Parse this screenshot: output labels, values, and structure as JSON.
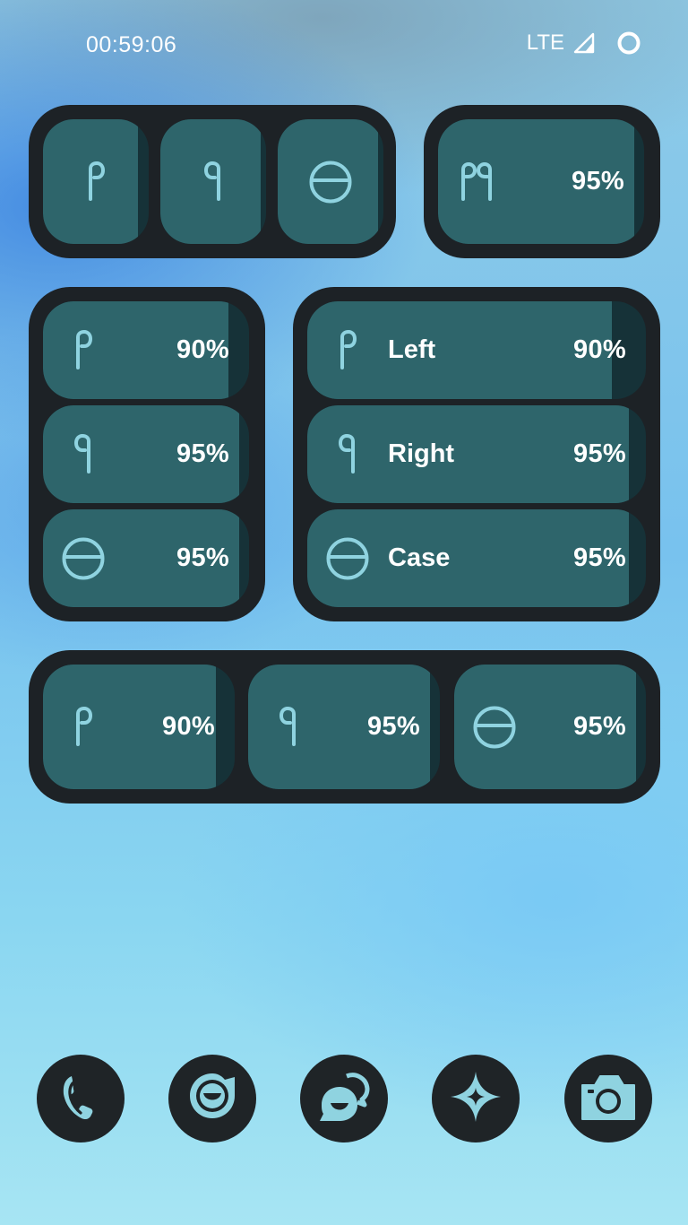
{
  "status_bar": {
    "time": "00:59:06",
    "network": "LTE",
    "icons": [
      "signal-icon",
      "battery-ring-icon"
    ]
  },
  "colors": {
    "frame": "#1d2226",
    "tile_fill": "#2e656b",
    "tile_empty": "#163238",
    "icon": "#8fd3e0",
    "text": "#ffffff"
  },
  "widget_icons_only": {
    "items": [
      {
        "icon": "left-earbud-icon",
        "level": 0.9
      },
      {
        "icon": "right-earbud-icon",
        "level": 0.95
      },
      {
        "icon": "case-icon",
        "level": 0.95
      }
    ]
  },
  "widget_combined": {
    "icon": "earbuds-pair-icon",
    "percent": "95%",
    "level": 0.95
  },
  "widget_column": {
    "items": [
      {
        "icon": "left-earbud-icon",
        "percent": "90%",
        "level": 0.9
      },
      {
        "icon": "right-earbud-icon",
        "percent": "95%",
        "level": 0.95
      },
      {
        "icon": "case-icon",
        "percent": "95%",
        "level": 0.95
      }
    ]
  },
  "widget_labeled": {
    "items": [
      {
        "icon": "left-earbud-icon",
        "label": "Left",
        "percent": "90%",
        "level": 0.9
      },
      {
        "icon": "right-earbud-icon",
        "label": "Right",
        "percent": "95%",
        "level": 0.95
      },
      {
        "icon": "case-icon",
        "label": "Case",
        "percent": "95%",
        "level": 0.95
      }
    ]
  },
  "widget_row": {
    "items": [
      {
        "icon": "left-earbud-icon",
        "percent": "90%",
        "level": 0.9
      },
      {
        "icon": "right-earbud-icon",
        "percent": "95%",
        "level": 0.95
      },
      {
        "icon": "case-icon",
        "percent": "95%",
        "level": 0.95
      }
    ]
  },
  "dock": {
    "apps": [
      "phone-icon",
      "messaging-icon",
      "chat-bubbles-icon",
      "sparkle-icon",
      "camera-icon"
    ]
  }
}
